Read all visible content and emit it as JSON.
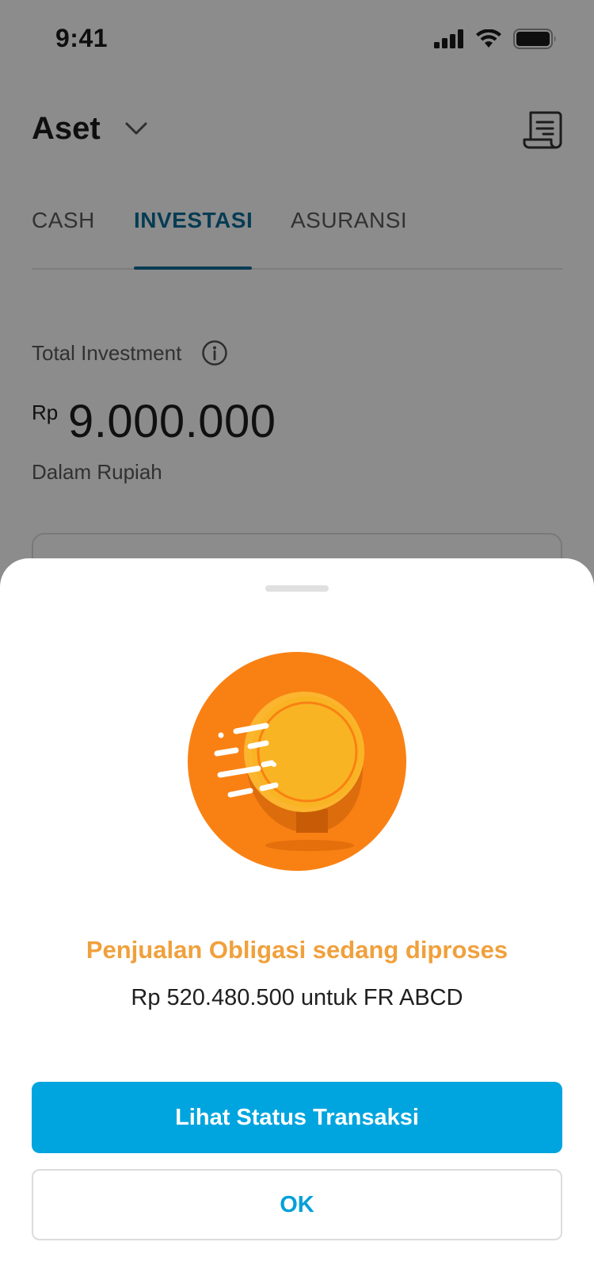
{
  "status_bar": {
    "time": "9:41"
  },
  "header": {
    "title": "Aset"
  },
  "tabs": [
    {
      "label": "CASH",
      "active": false
    },
    {
      "label": "INVESTASI",
      "active": true
    },
    {
      "label": "ASURANSI",
      "active": false
    }
  ],
  "summary": {
    "label": "Total Investment",
    "currency": "Rp",
    "amount": "9.000.000",
    "sublabel": "Dalam Rupiah"
  },
  "sheet": {
    "title": "Penjualan Obligasi sedang diproses",
    "subtitle": "Rp 520.480.500 untuk FR ABCD",
    "primary_button": "Lihat Status Transaksi",
    "secondary_button": "OK"
  },
  "colors": {
    "accent": "#0c6e9a",
    "primary_button": "#00a5df",
    "title_orange": "#f0a03c",
    "coin_bg": "#f98113",
    "coin": "#f9b423"
  },
  "icons": [
    "signal-icon",
    "wifi-icon",
    "battery-icon",
    "chevron-down-icon",
    "document-icon",
    "info-icon",
    "coin-icon"
  ]
}
